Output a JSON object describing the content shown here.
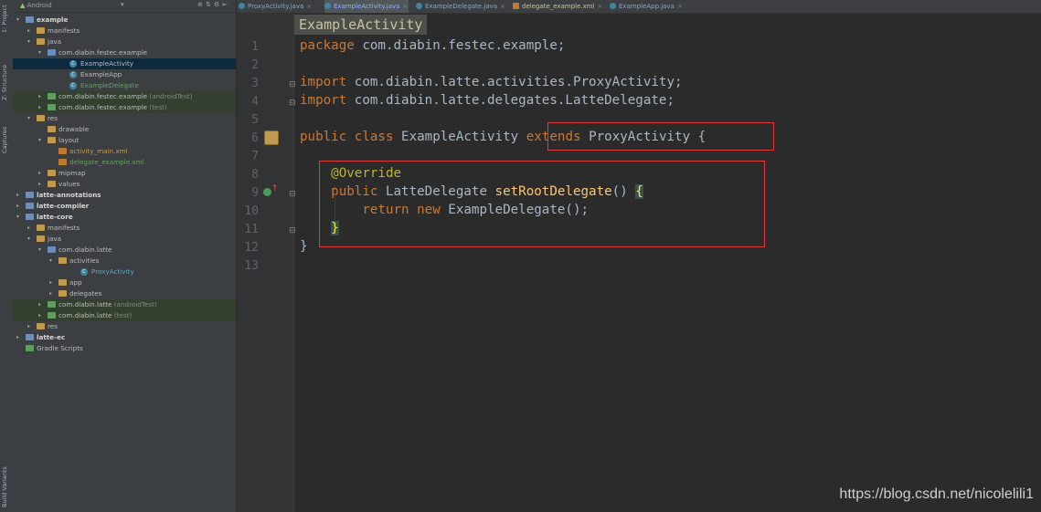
{
  "stripe": {
    "project_label": "1: Project",
    "structure_label": "Z: Structure",
    "captures_label": "Captures",
    "build_variants_label": "Build Variants"
  },
  "panel": {
    "view_selector": "Android",
    "tree": [
      {
        "label": "example",
        "style": "bold",
        "icon": "module"
      },
      {
        "label": "manifests",
        "icon": "folder"
      },
      {
        "label": "java",
        "icon": "folder"
      },
      {
        "label": "com.diabin.festec.example",
        "icon": "folder"
      },
      {
        "label": "ExampleActivity",
        "icon": "class"
      },
      {
        "label": "ExampleApp",
        "icon": "class"
      },
      {
        "label": "ExampleDelegate",
        "icon": "class"
      },
      {
        "label": "com.diabin.festec.example",
        "suffix": "(androidTest)",
        "icon": "folder"
      },
      {
        "label": "com.diabin.festec.example",
        "suffix": "(test)",
        "icon": "folder"
      },
      {
        "label": "res",
        "icon": "folder"
      },
      {
        "label": "drawable",
        "icon": "folder"
      },
      {
        "label": "layout",
        "icon": "folder"
      },
      {
        "label": "activity_main.xml",
        "icon": "xml"
      },
      {
        "label": "delegate_example.xml",
        "icon": "xml"
      },
      {
        "label": "mipmap",
        "icon": "folder"
      },
      {
        "label": "values",
        "icon": "folder"
      },
      {
        "label": "latte-annotations",
        "style": "bold",
        "icon": "module"
      },
      {
        "label": "latte-compiler",
        "style": "bold",
        "icon": "module"
      },
      {
        "label": "latte-core",
        "style": "bold",
        "icon": "module"
      },
      {
        "label": "manifests",
        "icon": "folder"
      },
      {
        "label": "java",
        "icon": "folder"
      },
      {
        "label": "com.diabin.latte",
        "icon": "folder"
      },
      {
        "label": "activities",
        "icon": "folder"
      },
      {
        "label": "ProxyActivity",
        "icon": "class"
      },
      {
        "label": "app",
        "icon": "folder"
      },
      {
        "label": "delegates",
        "icon": "folder"
      },
      {
        "label": "com.diabin.latte",
        "suffix": "(androidTest)",
        "icon": "folder"
      },
      {
        "label": "com.diabin.latte",
        "suffix": "(test)",
        "icon": "folder"
      },
      {
        "label": "res",
        "icon": "folder"
      },
      {
        "label": "latte-ec",
        "style": "bold",
        "icon": "module"
      },
      {
        "label": "Gradle Scripts",
        "icon": "gradle"
      }
    ]
  },
  "tabs": [
    {
      "label": "ProxyActivity.java"
    },
    {
      "label": "ExampleActivity.java"
    },
    {
      "label": "ExampleDelegate.java"
    },
    {
      "label": "delegate_example.xml"
    },
    {
      "label": "ExampleApp.java"
    }
  ],
  "editor": {
    "breadcrumb": "ExampleActivity",
    "line_numbers": [
      "1",
      "2",
      "3",
      "4",
      "5",
      "6",
      "7",
      "8",
      "9",
      "10",
      "11",
      "12",
      "13"
    ],
    "code": {
      "l1_kw": "package",
      "l1_rest": " com.diabin.festec.example;",
      "l3_kw": "import",
      "l3_rest": " com.diabin.latte.activities.ProxyActivity;",
      "l4_kw": "import",
      "l4_rest": " com.diabin.latte.delegates.LatteDelegate;",
      "l6_kw1": "public",
      "l6_kw2": "class",
      "l6_name": " ExampleActivity ",
      "l6_kw3": "extends",
      "l6_rest": " ProxyActivity {",
      "l8_ann": "@Override",
      "l9_kw": "public",
      "l9_type": " LatteDelegate ",
      "l9_fn": "setRootDelegate",
      "l9_paren": "() ",
      "l9_brace": "{",
      "l10_kw1": "return",
      "l10_kw2": "new",
      "l10_rest": " ExampleDelegate();",
      "l11_brace": "}",
      "l12_brace": "}"
    }
  },
  "watermark": "https://blog.csdn.net/nicolelili1"
}
